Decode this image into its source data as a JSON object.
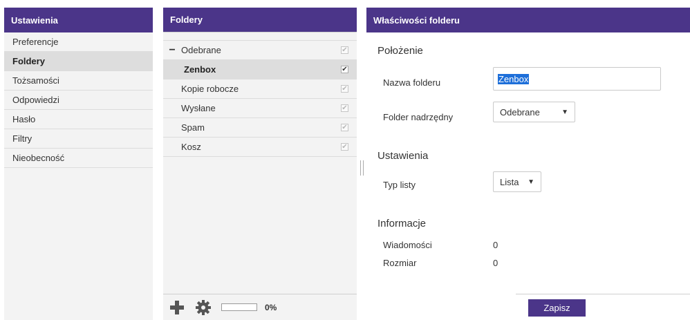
{
  "settings": {
    "title": "Ustawienia",
    "items": [
      {
        "label": "Preferencje",
        "active": false
      },
      {
        "label": "Foldery",
        "active": true
      },
      {
        "label": "Tożsamości",
        "active": false
      },
      {
        "label": "Odpowiedzi",
        "active": false
      },
      {
        "label": "Hasło",
        "active": false
      },
      {
        "label": "Filtry",
        "active": false
      },
      {
        "label": "Nieobecność",
        "active": false
      }
    ]
  },
  "folders": {
    "title": "Foldery",
    "toggle_symbol": "−",
    "items": [
      {
        "label": "Odebrane",
        "subscribed": true
      },
      {
        "label": "Zenbox",
        "subscribed": true,
        "selected": true
      },
      {
        "label": "Kopie robocze",
        "subscribed": true
      },
      {
        "label": "Wysłane",
        "subscribed": true
      },
      {
        "label": "Spam",
        "subscribed": true
      },
      {
        "label": "Kosz",
        "subscribed": true
      }
    ],
    "checkmark": "✔",
    "quota_percent": 0,
    "quota_text": "0%"
  },
  "properties": {
    "title": "Właściwości folderu",
    "location": {
      "section": "Położenie",
      "name_label": "Nazwa folderu",
      "name_value": "Zenbox",
      "parent_label": "Folder nadrzędny",
      "parent_value": "Odebrane"
    },
    "settings": {
      "section": "Ustawienia",
      "list_type_label": "Typ listy",
      "list_type_value": "Lista"
    },
    "info": {
      "section": "Informacje",
      "messages_label": "Wiadomości",
      "messages_value": "0",
      "size_label": "Rozmiar",
      "size_value": "0"
    },
    "arrow": "▼",
    "save_label": "Zapisz"
  },
  "colors": {
    "header": "#4b3589",
    "panel_bg": "#f3f3f3",
    "active_row": "#dddddd"
  }
}
